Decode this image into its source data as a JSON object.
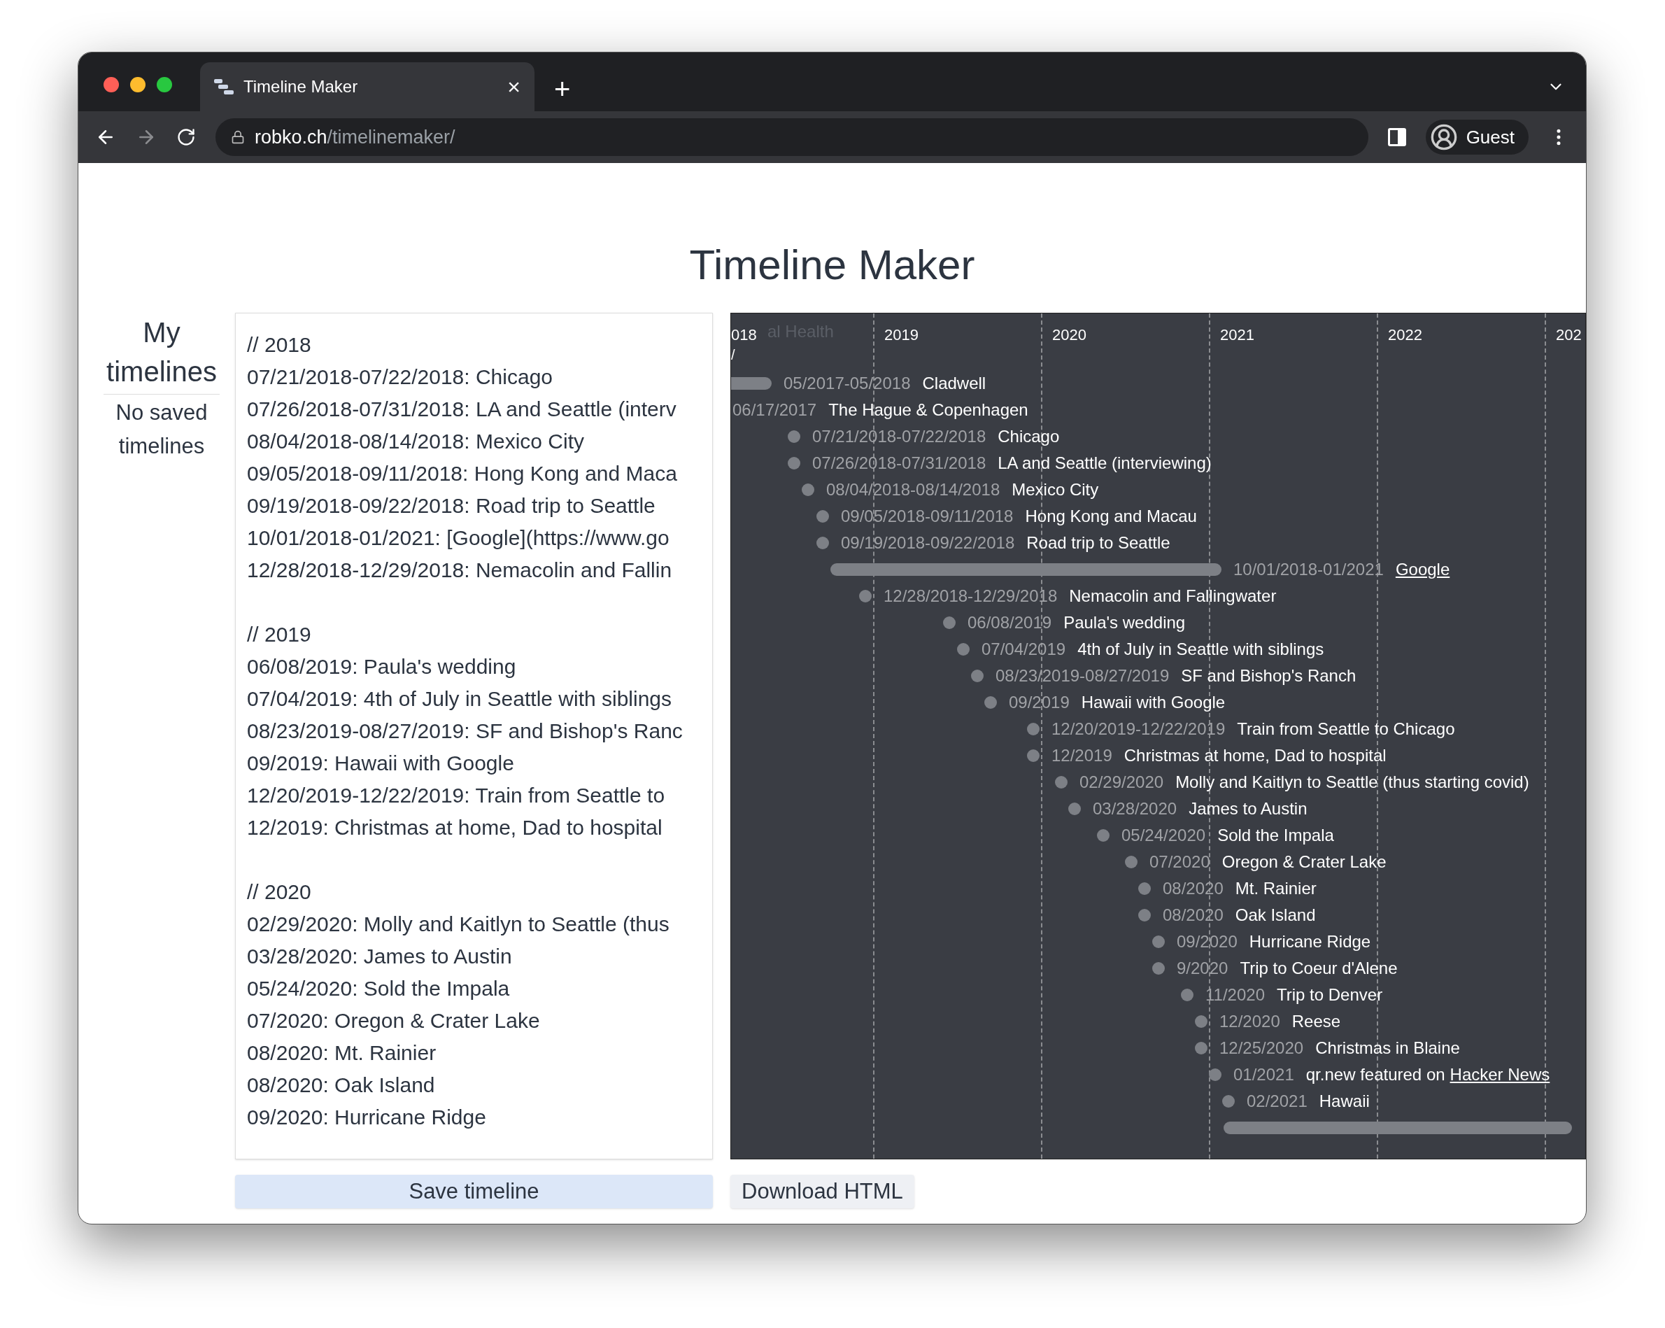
{
  "browser": {
    "tab": {
      "title": "Timeline Maker",
      "close": "×"
    },
    "new_tab": "+",
    "url": {
      "host": "robko.ch",
      "path": "/timelinemaker/"
    },
    "profile": "Guest"
  },
  "page": {
    "title": "Timeline Maker"
  },
  "sidebar": {
    "heading": "My timelines",
    "empty": "No saved timelines"
  },
  "editor": {
    "groups": [
      [
        "// 2018",
        "07/21/2018-07/22/2018: Chicago",
        "07/26/2018-07/31/2018: LA and Seattle (interv",
        "08/04/2018-08/14/2018: Mexico City",
        "09/05/2018-09/11/2018: Hong Kong and Maca",
        "09/19/2018-09/22/2018: Road trip to Seattle",
        "10/01/2018-01/2021: [Google](https://www.go",
        "12/28/2018-12/29/2018: Nemacolin and Fallin"
      ],
      [
        "// 2019",
        "06/08/2019: Paula's wedding",
        "07/04/2019: 4th of July in Seattle with siblings",
        "08/23/2019-08/27/2019: SF and Bishop's Ranc",
        "09/2019: Hawaii with Google",
        "12/20/2019-12/22/2019: Train from Seattle to",
        "12/2019: Christmas at home, Dad to hospital"
      ],
      [
        "// 2020",
        "02/29/2020: Molly and Kaitlyn to Seattle (thus",
        "03/28/2020: James to Austin",
        "05/24/2020: Sold the Impala",
        "07/2020: Oregon & Crater Lake",
        "08/2020: Mt. Rainier",
        "08/2020: Oak Island",
        "09/2020: Hurricane Ridge"
      ]
    ]
  },
  "timeline": {
    "years": [
      "018",
      "2019",
      "2020",
      "2021",
      "2022",
      "202"
    ],
    "faded_title": "al Health",
    "faded_mark": "/",
    "events": [
      {
        "kind": "bar",
        "date": "05/2017-05/2018",
        "label": "Cladwell"
      },
      {
        "kind": "text",
        "date": "06/17/2017",
        "label": "The Hague & Copenhagen"
      },
      {
        "kind": "dot",
        "date": "07/21/2018-07/22/2018",
        "label": "Chicago"
      },
      {
        "kind": "dot",
        "date": "07/26/2018-07/31/2018",
        "label": "LA and Seattle (interviewing)"
      },
      {
        "kind": "dot",
        "date": "08/04/2018-08/14/2018",
        "label": "Mexico City"
      },
      {
        "kind": "dot",
        "date": "09/05/2018-09/11/2018",
        "label": "Hong Kong and Macau"
      },
      {
        "kind": "dot",
        "date": "09/19/2018-09/22/2018",
        "label": "Road trip to Seattle"
      },
      {
        "kind": "bar",
        "date": "10/01/2018-01/2021",
        "link": "Google"
      },
      {
        "kind": "dot",
        "date": "12/28/2018-12/29/2018",
        "label": "Nemacolin and Fallingwater"
      },
      {
        "kind": "dot",
        "date": "06/08/2019",
        "label": "Paula's wedding"
      },
      {
        "kind": "dot",
        "date": "07/04/2019",
        "label": "4th of July in Seattle with siblings"
      },
      {
        "kind": "dot",
        "date": "08/23/2019-08/27/2019",
        "label": "SF and Bishop's Ranch"
      },
      {
        "kind": "dot",
        "date": "09/2019",
        "label": "Hawaii with Google"
      },
      {
        "kind": "dot",
        "date": "12/20/2019-12/22/2019",
        "label": "Train from Seattle to Chicago"
      },
      {
        "kind": "dot",
        "date": "12/2019",
        "label": "Christmas at home, Dad to hospital"
      },
      {
        "kind": "dot",
        "date": "02/29/2020",
        "label": "Molly and Kaitlyn to Seattle (thus starting covid)"
      },
      {
        "kind": "dot",
        "date": "03/28/2020",
        "label": "James to Austin"
      },
      {
        "kind": "dot",
        "date": "05/24/2020",
        "label": "Sold the Impala"
      },
      {
        "kind": "dot",
        "date": "07/2020",
        "label": "Oregon & Crater Lake"
      },
      {
        "kind": "dot",
        "date": "08/2020",
        "label": "Mt. Rainier"
      },
      {
        "kind": "dot",
        "date": "08/2020",
        "label": "Oak Island"
      },
      {
        "kind": "dot",
        "date": "09/2020",
        "label": "Hurricane Ridge"
      },
      {
        "kind": "dot",
        "date": "9/2020",
        "label": "Trip to Coeur d'Alene"
      },
      {
        "kind": "dot",
        "date": "11/2020",
        "label": "Trip to Denver"
      },
      {
        "kind": "dot",
        "date": "12/2020",
        "label": "Reese"
      },
      {
        "kind": "dot",
        "date": "12/25/2020",
        "label": "Christmas in Blaine"
      },
      {
        "kind": "dot",
        "date": "01/2021",
        "label": "qr.new featured on",
        "link": "Hacker News"
      },
      {
        "kind": "dot",
        "date": "02/2021",
        "label": "Hawaii"
      },
      {
        "kind": "bar"
      }
    ]
  },
  "buttons": [
    {
      "label": "Save timeline",
      "kind": "primary"
    },
    {
      "label": "Download HTML",
      "kind": "secondary"
    }
  ]
}
